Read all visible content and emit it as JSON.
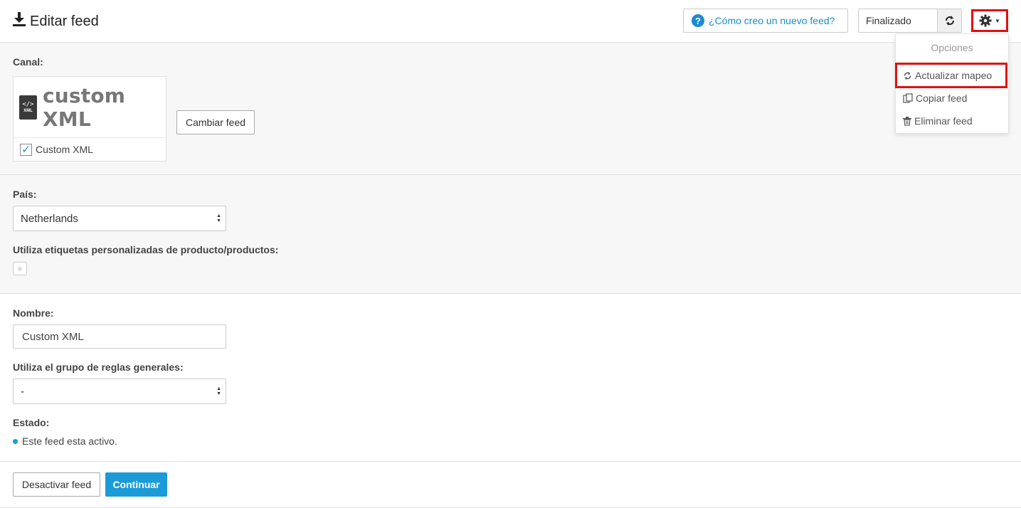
{
  "header": {
    "title": "Editar feed",
    "help_label": "¿Cómo creo un nuevo feed?",
    "status_value": "Finalizado"
  },
  "dropdown": {
    "header": "Opciones",
    "items": [
      {
        "label": "Actualizar mapeo",
        "icon": "refresh-icon"
      },
      {
        "label": "Copiar feed",
        "icon": "copy-icon"
      },
      {
        "label": "Eliminar feed",
        "icon": "trash-icon"
      }
    ]
  },
  "channel": {
    "label": "Canal:",
    "logo_text": "custom XML",
    "logo_file_code": "</>",
    "logo_file_ext": "XML",
    "name": "Custom XML",
    "checked": true,
    "change_button": "Cambiar feed"
  },
  "country": {
    "label": "País:",
    "value": "Netherlands"
  },
  "custom_labels": {
    "label": "Utiliza etiquetas personalizadas de producto/productos:"
  },
  "name_field": {
    "label": "Nombre:",
    "value": "Custom XML"
  },
  "rules": {
    "label": "Utiliza el grupo de reglas generales:",
    "value": "-"
  },
  "estado": {
    "label": "Estado:",
    "text": "Este feed esta activo."
  },
  "footer": {
    "deactivate_button": "Desactivar feed",
    "continue_button": "Continuar"
  },
  "colors": {
    "accent": "#1a9bd8",
    "highlight": "#e01010"
  }
}
